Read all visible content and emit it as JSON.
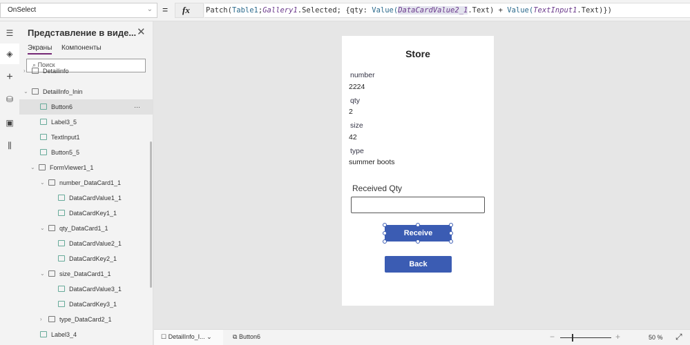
{
  "formula_bar": {
    "property": "OnSelect",
    "equals": "=",
    "fx": "fx",
    "formula_parts": [
      "Patch(",
      "Table1",
      ";",
      "Gallery1",
      ".Selected; {qty: ",
      "Value(",
      "DataCardValue2_1",
      ".Text) + ",
      "Value(",
      "TextInput1",
      ".Text)})"
    ]
  },
  "panel": {
    "title": "Представление в виде...",
    "tabs": [
      "Экраны",
      "Компоненты"
    ],
    "search_placeholder": "Поиск",
    "tree": [
      {
        "label": "Detailinfo",
        "level": 0,
        "icon": "screen-icon",
        "chevron": "right"
      },
      {
        "label": "DetailInfo_Inin",
        "level": 0,
        "icon": "screen-icon",
        "chevron": "down"
      },
      {
        "label": "Button6",
        "level": 1,
        "icon": "button-icon",
        "selected": true
      },
      {
        "label": "Label3_5",
        "level": 1,
        "icon": "label-icon"
      },
      {
        "label": "TextInput1",
        "level": 1,
        "icon": "textinput-icon"
      },
      {
        "label": "Button5_5",
        "level": 1,
        "icon": "button-icon"
      },
      {
        "label": "FormViewer1_1",
        "level": 1,
        "icon": "form-icon",
        "chevron": "down"
      },
      {
        "label": "number_DataCard1_1",
        "level": 2,
        "icon": "card-icon",
        "chevron": "down"
      },
      {
        "label": "DataCardValue1_1",
        "level": 3,
        "icon": "label-icon"
      },
      {
        "label": "DataCardKey1_1",
        "level": 3,
        "icon": "label-icon"
      },
      {
        "label": "qty_DataCard1_1",
        "level": 2,
        "icon": "card-icon",
        "chevron": "down"
      },
      {
        "label": "DataCardValue2_1",
        "level": 3,
        "icon": "label-icon"
      },
      {
        "label": "DataCardKey2_1",
        "level": 3,
        "icon": "label-icon"
      },
      {
        "label": "size_DataCard1_1",
        "level": 2,
        "icon": "card-icon",
        "chevron": "down"
      },
      {
        "label": "DataCardValue3_1",
        "level": 3,
        "icon": "label-icon"
      },
      {
        "label": "DataCardKey3_1",
        "level": 3,
        "icon": "label-icon"
      },
      {
        "label": "type_DataCard2_1",
        "level": 2,
        "icon": "card-icon",
        "chevron": "right"
      },
      {
        "label": "Label3_4",
        "level": 1,
        "icon": "label-icon"
      }
    ],
    "more": "···"
  },
  "screen": {
    "title": "Store",
    "fields": [
      {
        "key": "number",
        "value": "2224"
      },
      {
        "key": "qty",
        "value": "2"
      },
      {
        "key": "size",
        "value": "42"
      },
      {
        "key": "type",
        "value": "summer boots"
      }
    ],
    "received_label": "Received Qty",
    "received_value": "",
    "receive_button": "Receive",
    "back_button": "Back"
  },
  "bottom": {
    "screen": "DetailInfo_I...",
    "control": "Button6",
    "zoom": "50",
    "zoom_unit": "%",
    "zoom_level_percent": 50
  },
  "colors": {
    "accent": "#742774",
    "button": "#3b5cb3"
  }
}
